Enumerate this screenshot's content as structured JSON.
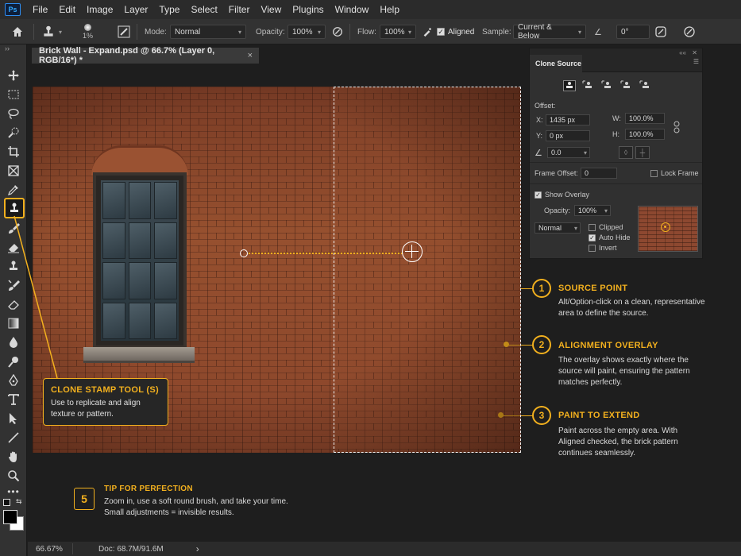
{
  "app": {
    "logo": "Ps"
  },
  "menu": [
    "File",
    "Edit",
    "Image",
    "Layer",
    "Type",
    "Select",
    "Filter",
    "View",
    "Plugins",
    "Window",
    "Help"
  ],
  "options": {
    "brush_size": "1%",
    "mode_label": "Mode:",
    "mode_value": "Normal",
    "opacity_label": "Opacity:",
    "opacity_value": "100%",
    "flow_label": "Flow:",
    "flow_value": "100%",
    "aligned_label": "Aligned",
    "sample_label": "Sample:",
    "sample_value": "Current & Below",
    "angle_value": "0°"
  },
  "document": {
    "tab_title": "Brick Wall - Expand.psd @ 66.7% (Layer 0, RGB/16*) *",
    "close_glyph": "×"
  },
  "clone_source": {
    "title": "Clone Source",
    "offset_label": "Offset:",
    "x_label": "X:",
    "x_value": "1435 px",
    "y_label": "Y:",
    "y_value": "0 px",
    "w_label": "W:",
    "w_value": "100.0%",
    "h_label": "H:",
    "h_value": "100.0%",
    "angle_value": "0.0",
    "frame_offset_label": "Frame Offset:",
    "frame_offset_value": "0",
    "lock_frame_label": "Lock Frame",
    "show_overlay_label": "Show Overlay",
    "opacity_label": "Opacity:",
    "opacity_value": "100%",
    "blend_value": "Normal",
    "clipped_label": "Clipped",
    "auto_hide_label": "Auto Hide",
    "invert_label": "Invert"
  },
  "callouts": [
    {
      "num": "1",
      "title": "SOURCE POINT",
      "body": "Alt/Option-click on a clean, representative area to define the source."
    },
    {
      "num": "2",
      "title": "ALIGNMENT OVERLAY",
      "body": "The overlay shows exactly where the source will paint, ensuring the pattern matches perfectly."
    },
    {
      "num": "3",
      "title": "PAINT TO EXTEND",
      "body": "Paint across the empty area. With Aligned checked, the brick pattern continues seamlessly."
    }
  ],
  "tool_card": {
    "title": "CLONE STAMP TOOL (S)",
    "body": "Use to replicate and align texture or pattern."
  },
  "tip": {
    "num": "5",
    "title": "TIP FOR PERFECTION",
    "line1": "Zoom in, use a soft round brush, and take your time.",
    "line2": "Small adjustments = invisible results."
  },
  "status": {
    "zoom": "66.67%",
    "doc": "Doc: 68.7M/91.6M",
    "arrow": "›"
  },
  "colors": {
    "accent": "#f2b01e",
    "brick": "#8d4830"
  }
}
